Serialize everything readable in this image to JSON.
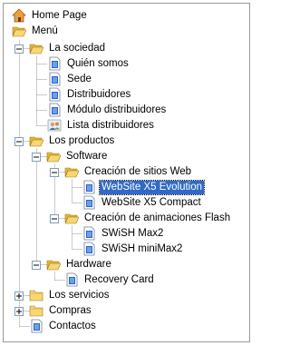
{
  "tree": {
    "nodes": [
      {
        "label": "Home Page",
        "icon": "home-icon"
      },
      {
        "label": "Menú",
        "icon": "folder-open-icon"
      },
      {
        "label": "La sociedad",
        "icon": "folder-open-icon",
        "toggle": "minus"
      },
      {
        "label": "Quién somos",
        "icon": "document-icon"
      },
      {
        "label": "Sede",
        "icon": "document-icon"
      },
      {
        "label": "Distribuidores",
        "icon": "document-icon"
      },
      {
        "label": "Módulo distribuidores",
        "icon": "document-icon"
      },
      {
        "label": "Lista distribuidores",
        "icon": "people-icon"
      },
      {
        "label": "Los productos",
        "icon": "folder-open-icon",
        "toggle": "minus"
      },
      {
        "label": "Software",
        "icon": "folder-open-icon",
        "toggle": "minus"
      },
      {
        "label": "Creación de sitios Web",
        "icon": "folder-open-icon",
        "toggle": "minus"
      },
      {
        "label": "WebSite X5 Evolution",
        "icon": "document-icon",
        "selected": true
      },
      {
        "label": "WebSite X5 Compact",
        "icon": "document-icon"
      },
      {
        "label": "Creación de animaciones Flash",
        "icon": "folder-open-icon",
        "toggle": "minus"
      },
      {
        "label": "SWiSH Max2",
        "icon": "document-icon"
      },
      {
        "label": "SWiSH miniMax2",
        "icon": "document-icon"
      },
      {
        "label": "Hardware",
        "icon": "folder-open-icon",
        "toggle": "minus"
      },
      {
        "label": "Recovery Card",
        "icon": "document-icon"
      },
      {
        "label": "Los servicios",
        "icon": "folder-closed-icon",
        "toggle": "plus"
      },
      {
        "label": "Compras",
        "icon": "folder-closed-icon",
        "toggle": "plus"
      },
      {
        "label": "Contactos",
        "icon": "document-icon"
      }
    ]
  },
  "colors": {
    "selection": "#316ac5",
    "folder": "#f2c94c",
    "doc_blue": "#2b63c6"
  }
}
